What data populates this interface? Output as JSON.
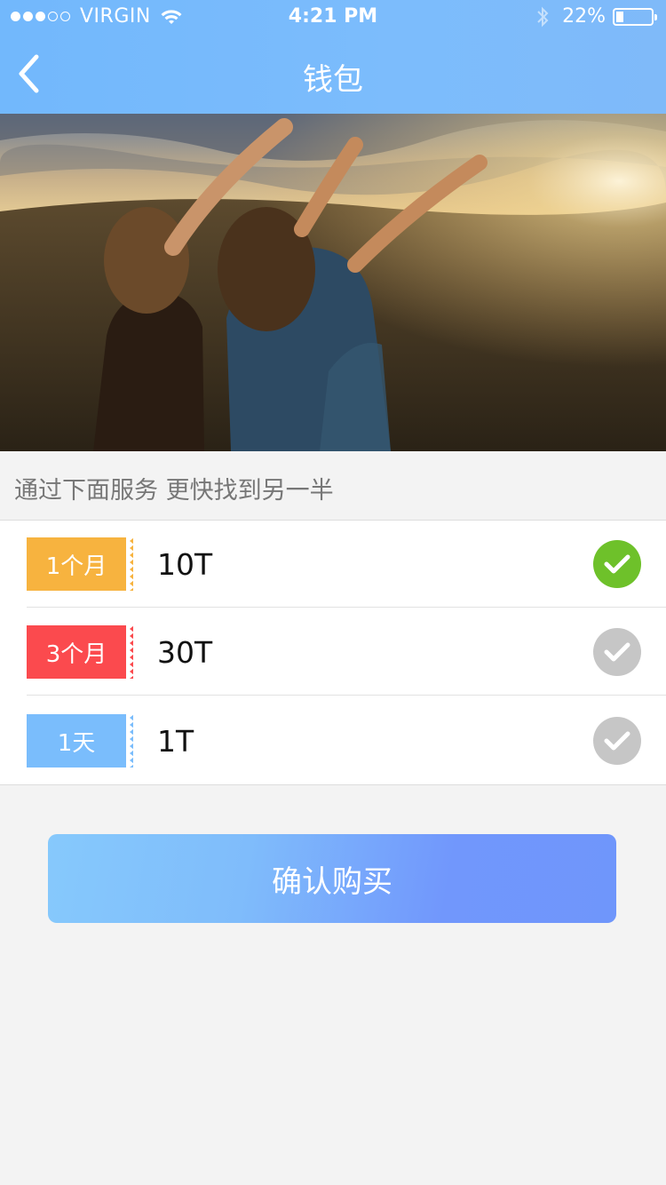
{
  "status_bar": {
    "carrier": "VIRGIN",
    "time": "4:21 PM",
    "battery": "22%",
    "battery_level": 0.22,
    "signal_bars": 3,
    "signal_total": 5
  },
  "nav": {
    "title": "钱包",
    "back_icon": "chevron-left-icon"
  },
  "hint": "通过下面服务 更快找到另一半",
  "plans": [
    {
      "tag": "1个月",
      "amount": "10T",
      "tag_color": "#f7b33f",
      "selected": true
    },
    {
      "tag": "3个月",
      "amount": "30T",
      "tag_color": "#fb4a4e",
      "selected": false
    },
    {
      "tag": "1天",
      "amount": "1T",
      "tag_color": "#7abdfc",
      "selected": false
    }
  ],
  "confirm_label": "确认购买",
  "colors": {
    "header": "#7cbcfc",
    "check_on": "#6ec12a",
    "check_off": "#c6c6c6",
    "button_start": "#86c9fc",
    "button_end": "#6f96fb"
  }
}
